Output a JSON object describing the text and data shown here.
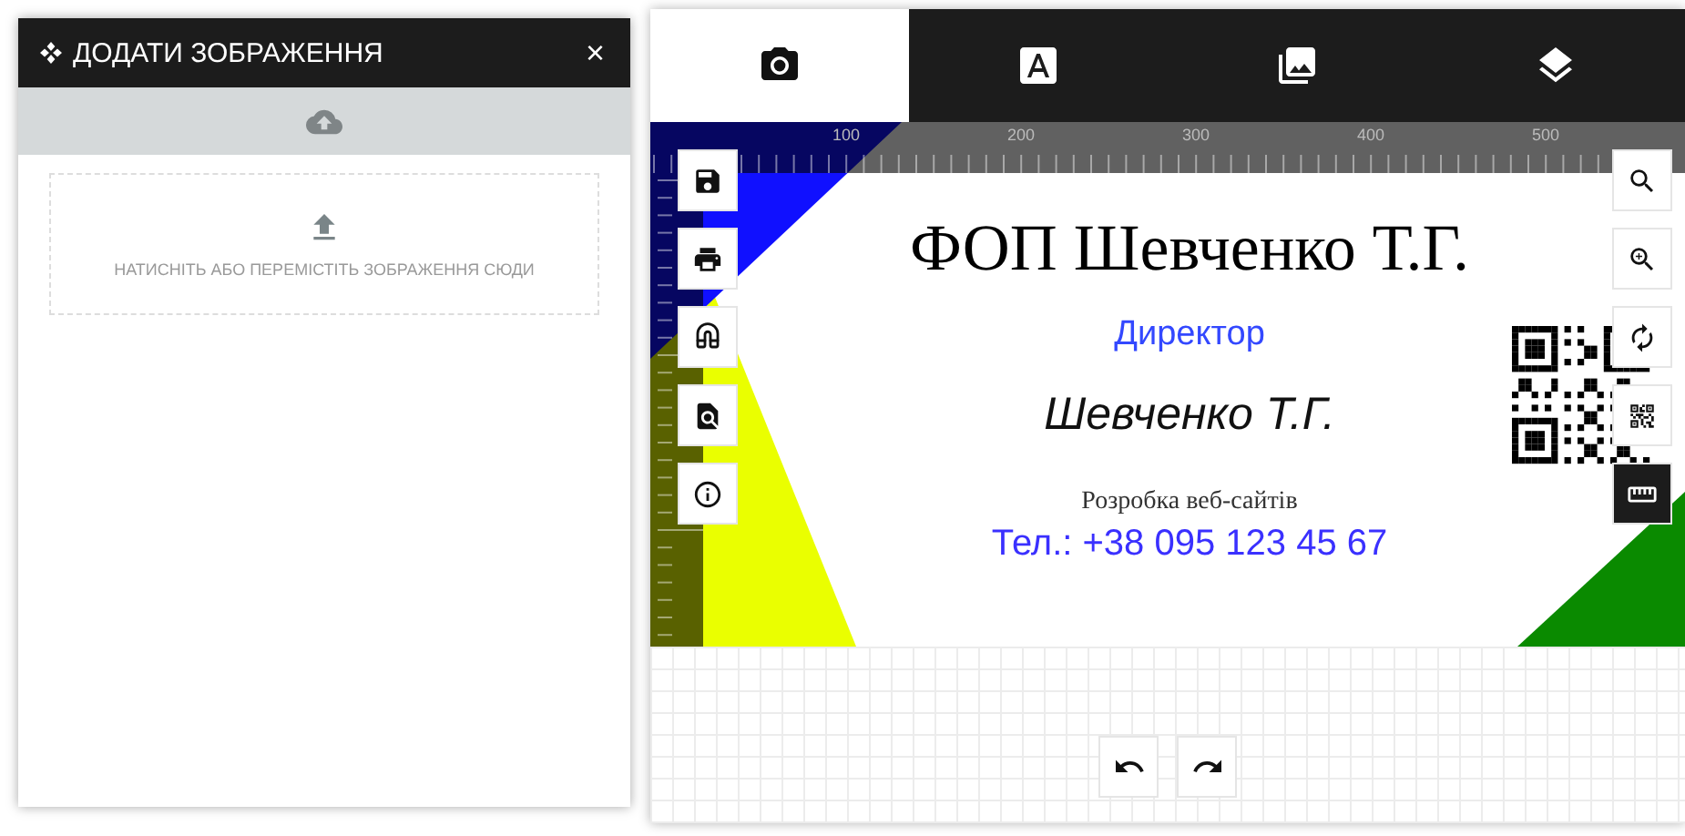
{
  "image_panel": {
    "title": "ДОДАТИ ЗОБРАЖЕННЯ",
    "close": "×",
    "drop_hint": "НАТИСНІТЬ АБО ПЕРЕМІСТІТЬ ЗОБРАЖЕННЯ СЮДИ"
  },
  "tabs": [
    {
      "kind": "camera",
      "selected": true
    },
    {
      "kind": "text",
      "selected": false
    },
    {
      "kind": "images",
      "selected": false
    },
    {
      "kind": "layers",
      "selected": false
    }
  ],
  "ruler_labels": [
    "100",
    "200",
    "300",
    "400",
    "500"
  ],
  "left_tools": [
    {
      "kind": "save"
    },
    {
      "kind": "print"
    },
    {
      "kind": "magnet"
    },
    {
      "kind": "find"
    },
    {
      "kind": "info"
    }
  ],
  "right_tools": [
    {
      "kind": "search",
      "on": false
    },
    {
      "kind": "zoom",
      "on": false
    },
    {
      "kind": "rotate",
      "on": false
    },
    {
      "kind": "qr",
      "on": false
    },
    {
      "kind": "ruler",
      "on": true
    }
  ],
  "card_texts": [
    {
      "kind": "title",
      "text": "ФОП Шевченко Т.Г."
    },
    {
      "kind": "role",
      "text": "Директор"
    },
    {
      "kind": "name",
      "text": "Шевченко Т.Г."
    },
    {
      "kind": "tagline",
      "text": "Розробка веб-сайтів"
    },
    {
      "kind": "phone",
      "text": "Тел.: +38 095 123 45 67"
    }
  ],
  "history": [
    {
      "kind": "undo"
    },
    {
      "kind": "redo"
    }
  ]
}
